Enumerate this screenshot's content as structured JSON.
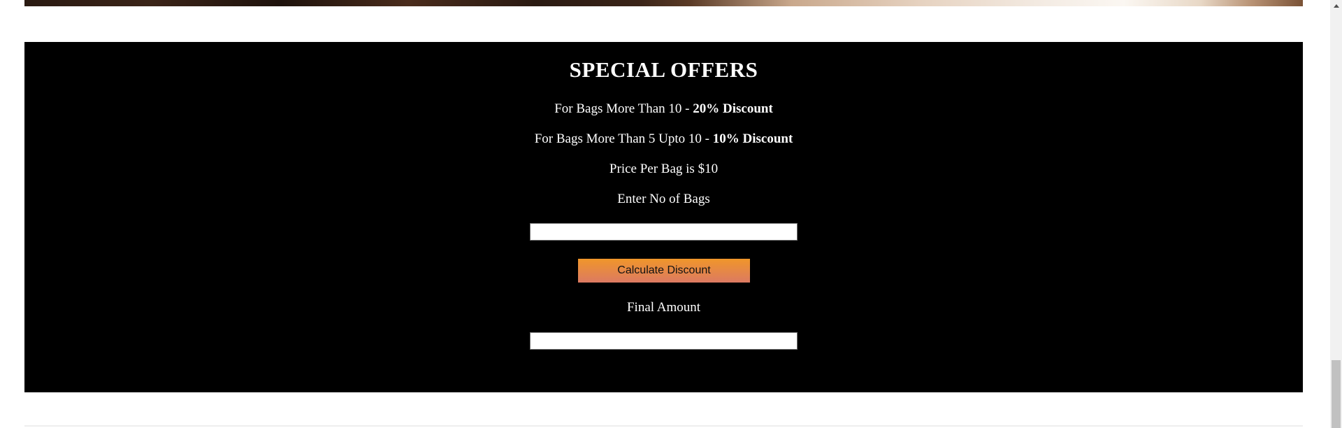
{
  "offers": {
    "title": "SPECIAL OFFERS",
    "line1_prefix": "For Bags More Than 10 - ",
    "line1_bold": "20% Discount",
    "line2_prefix": "For Bags More Than 5 Upto 10 - ",
    "line2_bold": "10% Discount",
    "price_text": "Price Per Bag is $10",
    "bags_label": "Enter No of Bags",
    "bags_value": "",
    "button_label": "Calculate Discount",
    "final_label": "Final Amount",
    "final_value": ""
  },
  "colors": {
    "section_background": "#000000",
    "button_gradient_top": "#f0962a",
    "button_gradient_bottom": "#dc7a62"
  }
}
